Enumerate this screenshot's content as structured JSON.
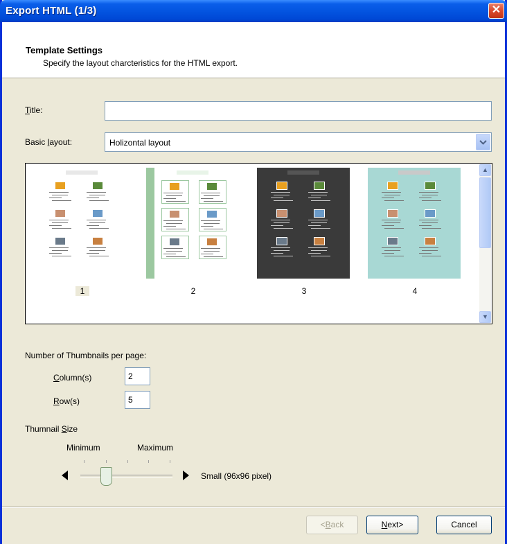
{
  "window": {
    "title": "Export HTML  (1/3)"
  },
  "header": {
    "title": "Template Settings",
    "subtitle": "Specify the layout charcteristics for the HTML export."
  },
  "form": {
    "title_label_prefix": "",
    "title_label_mnemonic": "T",
    "title_label_rest": "itle:",
    "title_value": "",
    "layout_label_prefix": "Basic ",
    "layout_label_mnemonic": "l",
    "layout_label_rest": "ayout:",
    "layout_value": "Holizontal layout"
  },
  "templates": [
    {
      "number": "1",
      "selected": true,
      "bg": "#FFFFFF",
      "caption_bg": "#E8E8E8",
      "card_bg": "#FFFFFF"
    },
    {
      "number": "2",
      "selected": false,
      "bg": "#FFFFFF",
      "caption_bg": "#E8F4E8",
      "card_bg": "#FFFFFF"
    },
    {
      "number": "3",
      "selected": false,
      "bg": "#3A3A3A",
      "caption_bg": "#555555",
      "card_bg": "#3A3A3A"
    },
    {
      "number": "4",
      "selected": false,
      "bg": "#A8D8D4",
      "caption_bg": "#C9C9C9",
      "card_bg": "#A8D8D4"
    }
  ],
  "thumbnails_per_page": {
    "label": "Number of Thumbnails per page:",
    "column_mnemonic": "C",
    "column_rest": "olumn(s)",
    "column_value": "2",
    "row_mnemonic": "R",
    "row_rest": "ow(s)",
    "row_value": "5"
  },
  "thumbnail_size": {
    "label_prefix": "Thumnail ",
    "label_mnemonic": "S",
    "label_rest": "ize",
    "min_label": "Minimum",
    "max_label": "Maximum",
    "current": "Small (96x96 pixel)",
    "level": 0.25
  },
  "buttons": {
    "back_prefix": "<",
    "back_mnemonic": "B",
    "back_rest": "ack",
    "next_mnemonic": "N",
    "next_rest": "ext>",
    "cancel": "Cancel"
  }
}
